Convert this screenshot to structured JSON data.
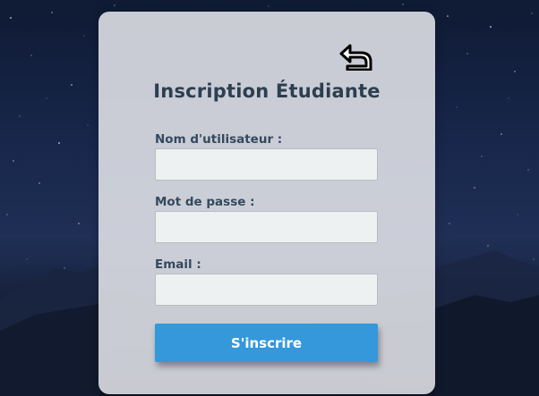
{
  "form": {
    "title": "Inscription Étudiante",
    "back_icon": "undo-arrow-icon",
    "fields": [
      {
        "label": "Nom d'utilisateur :",
        "value": "",
        "placeholder": ""
      },
      {
        "label": "Mot de passe :",
        "value": "",
        "placeholder": ""
      },
      {
        "label": "Email :",
        "value": "",
        "placeholder": ""
      }
    ],
    "submit_label": "S'inscrire"
  },
  "colors": {
    "accent": "#3498db",
    "title_text": "#2c3e50",
    "label_text": "#34495e",
    "card_background": "#e8e9ee",
    "night_sky": "#17264a"
  }
}
